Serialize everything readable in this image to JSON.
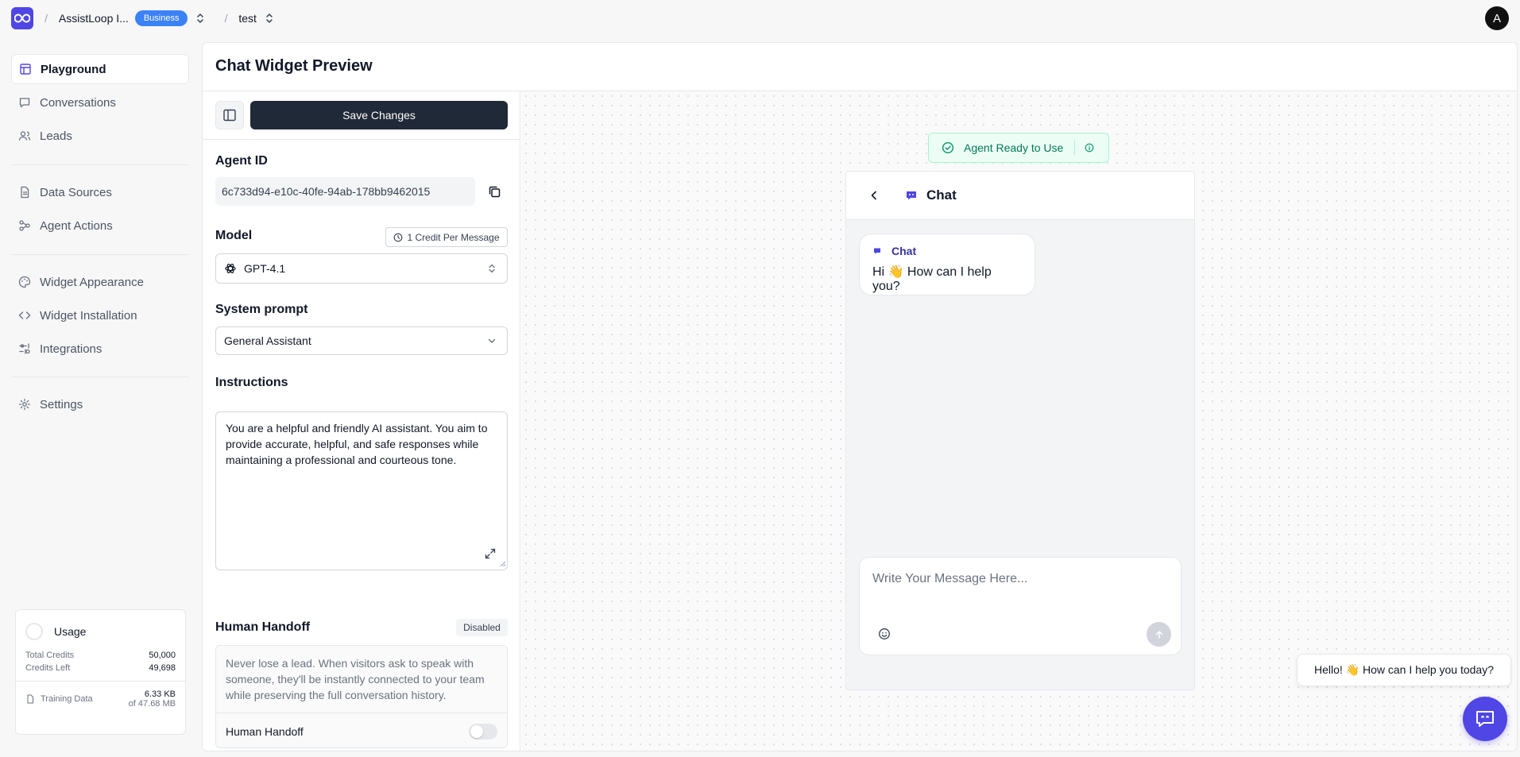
{
  "topbar": {
    "org_name": "AssistLoop I...",
    "plan": "Business",
    "project_name": "test",
    "separator": "/",
    "avatar_initial": "A"
  },
  "sidebar": {
    "items": [
      {
        "label": "Playground",
        "icon": "layout-icon",
        "active": true
      },
      {
        "label": "Conversations",
        "icon": "message-icon"
      },
      {
        "label": "Leads",
        "icon": "users-icon"
      },
      {
        "label": "Data Sources",
        "icon": "file-icon"
      },
      {
        "label": "Agent Actions",
        "icon": "actions-icon"
      },
      {
        "label": "Widget Appearance",
        "icon": "palette-icon"
      },
      {
        "label": "Widget Installation",
        "icon": "code-icon"
      },
      {
        "label": "Integrations",
        "icon": "integrations-icon"
      },
      {
        "label": "Settings",
        "icon": "gear-icon"
      }
    ]
  },
  "usage": {
    "title": "Usage",
    "total_credits_label": "Total Credits",
    "total_credits": "50,000",
    "credits_left_label": "Credits Left",
    "credits_left": "49,698",
    "training_label": "Training Data",
    "training_used": "6.33 KB",
    "training_total": "of 47.68 MB"
  },
  "main": {
    "title": "Chat Widget Preview"
  },
  "config": {
    "save_label": "Save Changes",
    "agent_id_label": "Agent ID",
    "agent_id": "6c733d94-e10c-40fe-94ab-178bb9462015",
    "model_label": "Model",
    "credit_badge": "1 Credit Per Message",
    "model_value": "GPT-4.1",
    "system_prompt_label": "System prompt",
    "system_prompt_value": "General Assistant",
    "instructions_label": "Instructions",
    "instructions_text": "You are a helpful and friendly AI assistant. You aim to provide accurate, helpful, and safe responses while maintaining a professional and courteous tone.",
    "handoff_label": "Human Handoff",
    "handoff_status": "Disabled",
    "handoff_desc": "Never lose a lead. When visitors ask to speak with someone, they'll be instantly connected to your team while preserving the full conversation history.",
    "handoff_toggle_label": "Human Handoff",
    "handoff_enabled": false
  },
  "preview": {
    "ready_label": "Agent Ready to Use",
    "chat_title": "Chat",
    "bubble_sender": "Chat",
    "bubble_message": "Hi 👋 How can I help you?",
    "composer_placeholder": "Write Your Message Here...",
    "greeting": "Hello! 👋 How can I help you today?"
  },
  "colors": {
    "brand": "#4f46e5",
    "success": "#047857",
    "dark_button": "#1f2937"
  }
}
